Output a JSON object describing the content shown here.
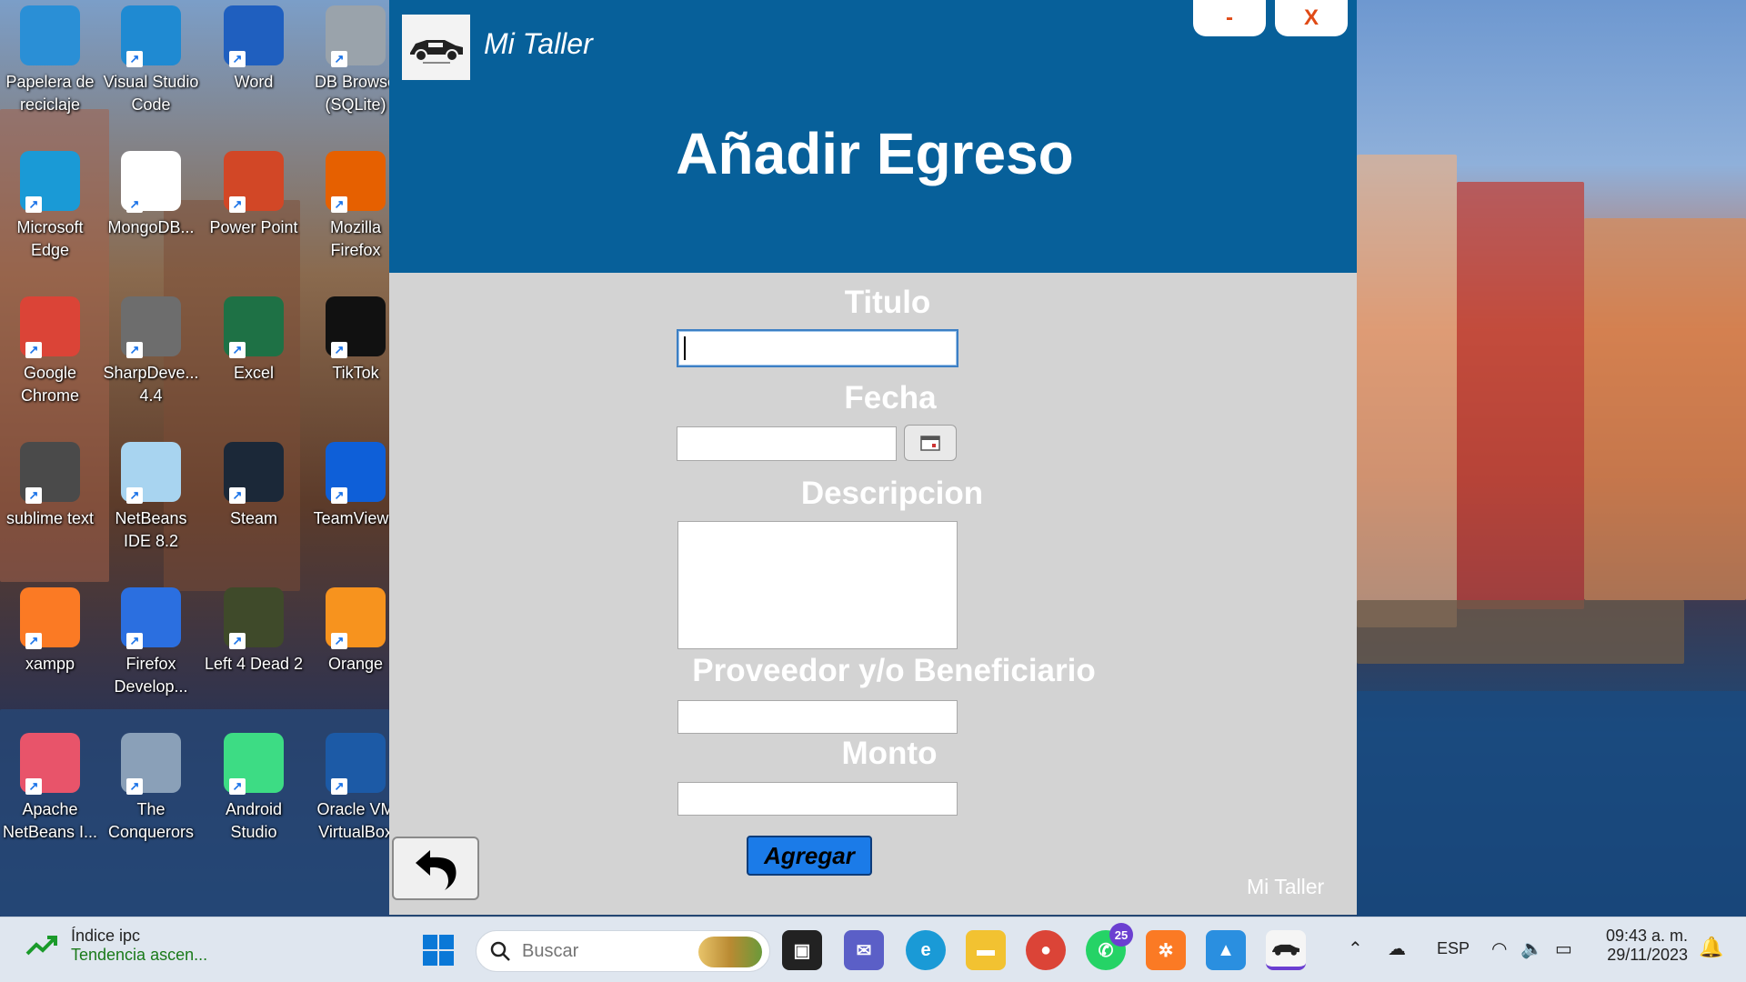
{
  "desktop": {
    "icons": [
      {
        "label": "Papelera de reciclaje",
        "icon": "recycle-bin-icon",
        "color": "#2a8fd6"
      },
      {
        "label": "Visual Studio Code",
        "icon": "vscode-icon",
        "color": "#1f8ad2"
      },
      {
        "label": "Word",
        "icon": "word-icon",
        "color": "#1f5fbf"
      },
      {
        "label": "DB Browse (SQLite)",
        "icon": "database-icon",
        "color": "#9aa3ab"
      },
      {
        "label": "Microsoft Edge",
        "icon": "edge-icon",
        "color": "#1a9ad6"
      },
      {
        "label": "MongoDB...",
        "icon": "mongodb-icon",
        "color": "#ffffff"
      },
      {
        "label": "Power Point",
        "icon": "powerpoint-icon",
        "color": "#d24726"
      },
      {
        "label": "Mozilla Firefox",
        "icon": "firefox-icon",
        "color": "#e66000"
      },
      {
        "label": "Google Chrome",
        "icon": "chrome-icon",
        "color": "#db4437"
      },
      {
        "label": "SharpDeve... 4.4",
        "icon": "sharpdevelop-icon",
        "color": "#6d6d6d"
      },
      {
        "label": "Excel",
        "icon": "excel-icon",
        "color": "#1e7145"
      },
      {
        "label": "TikTok",
        "icon": "tiktok-icon",
        "color": "#111111"
      },
      {
        "label": "sublime text",
        "icon": "sublime-icon",
        "color": "#4a4a4a"
      },
      {
        "label": "NetBeans IDE 8.2",
        "icon": "netbeans-cube-icon",
        "color": "#a8d4f0"
      },
      {
        "label": "Steam",
        "icon": "steam-icon",
        "color": "#1b2838"
      },
      {
        "label": "TeamViewe",
        "icon": "teamviewer-icon",
        "color": "#0e5fd8"
      },
      {
        "label": "xampp",
        "icon": "xampp-icon",
        "color": "#fb7a24"
      },
      {
        "label": "Firefox Develop...",
        "icon": "firefox-dev-icon",
        "color": "#2b6fe0"
      },
      {
        "label": "Left 4 Dead 2",
        "icon": "left4dead-icon",
        "color": "#3f4a2a"
      },
      {
        "label": "Orange",
        "icon": "orange-icon",
        "color": "#f7931e"
      },
      {
        "label": "Apache NetBeans I...",
        "icon": "apache-netbeans-icon",
        "color": "#e8546a"
      },
      {
        "label": "The Conquerors",
        "icon": "conquerors-icon",
        "color": "#8aa0b8"
      },
      {
        "label": "Android Studio",
        "icon": "android-studio-icon",
        "color": "#3ddc84"
      },
      {
        "label": "Oracle VM VirtualBox",
        "icon": "virtualbox-icon",
        "color": "#1c5aa6"
      }
    ]
  },
  "app": {
    "name": "Mi Taller",
    "minimize_label": "-",
    "close_label": "X",
    "page_title": "Añadir Egreso",
    "fields": {
      "titulo": {
        "label": "Titulo",
        "value": ""
      },
      "fecha": {
        "label": "Fecha",
        "value": ""
      },
      "descripcion": {
        "label": "Descripcion",
        "value": ""
      },
      "proveedor": {
        "label": "Proveedor y/o Beneficiario",
        "value": ""
      },
      "monto": {
        "label": "Monto",
        "value": ""
      }
    },
    "submit_label": "Agregar",
    "footer_brand": "Mi Taller",
    "header_color": "#07609a",
    "body_color": "#d3d3d3"
  },
  "taskbar": {
    "widget_title": "Índice ipc",
    "widget_subtitle": "Tendencia ascen...",
    "search_placeholder": "Buscar",
    "whatsapp_badge": "25",
    "language": "ESP",
    "time": "09:43 a. m.",
    "date": "29/11/2023"
  }
}
